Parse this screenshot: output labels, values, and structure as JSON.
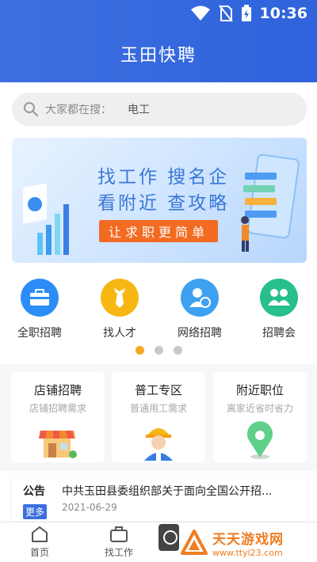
{
  "status_bar": {
    "time": "10:36"
  },
  "header": {
    "title": "玉田快聘"
  },
  "search": {
    "placeholder": "大家都在搜：",
    "keyword": "电工"
  },
  "banner": {
    "line1": "找工作  搜名企",
    "line2": "看附近  查攻略",
    "cta": "让求职更简单"
  },
  "categories": [
    {
      "label": "全职招聘",
      "icon": "briefcase-icon",
      "color": "#2b8df5"
    },
    {
      "label": "找人才",
      "icon": "tie-icon",
      "color": "#f7b713"
    },
    {
      "label": "网络招聘",
      "icon": "person-globe-icon",
      "color": "#3ea0f0"
    },
    {
      "label": "招聘会",
      "icon": "people-icon",
      "color": "#26c08a"
    }
  ],
  "carousel": {
    "pages": 3,
    "active": 0
  },
  "feature_cards": [
    {
      "title": "店铺招聘",
      "subtitle": "店铺招聘需求",
      "icon": "storefront-icon"
    },
    {
      "title": "普工专区",
      "subtitle": "普通用工需求",
      "icon": "worker-icon"
    },
    {
      "title": "附近职位",
      "subtitle": "离家近省时省力",
      "icon": "location-pin-icon"
    }
  ],
  "notice": {
    "tag": "公告",
    "more": "更多",
    "text": "中共玉田县委组织部关于面向全国公开招...",
    "date": "2021-06-29"
  },
  "tabbar": {
    "home": "首页",
    "jobs": "找工作"
  },
  "watermark": {
    "title": "天天游戏网",
    "url": "www.ttyl23.com"
  },
  "colors": {
    "primary": "#3166dd",
    "accent": "#f7a823",
    "cta": "#f26b21"
  }
}
